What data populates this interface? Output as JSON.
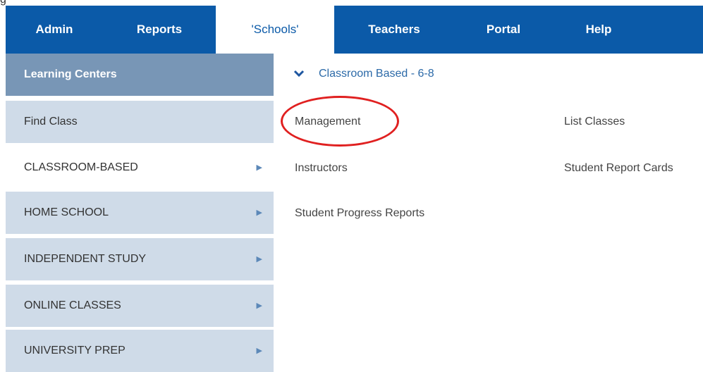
{
  "top_glyph": "g",
  "nav": {
    "tabs": [
      {
        "label": "Admin"
      },
      {
        "label": "Reports"
      },
      {
        "label": "'Schools'"
      },
      {
        "label": "Teachers"
      },
      {
        "label": "Portal"
      },
      {
        "label": "Help"
      }
    ]
  },
  "sidebar": {
    "header": "Learning Centers",
    "items": [
      {
        "label": "Find Class"
      },
      {
        "label": "CLASSROOM-BASED"
      },
      {
        "label": "HOME SCHOOL"
      },
      {
        "label": "INDEPENDENT STUDY"
      },
      {
        "label": "ONLINE CLASSES"
      },
      {
        "label": "UNIVERSITY PREP"
      }
    ]
  },
  "content": {
    "section_title": "Classroom Based - 6-8",
    "links": [
      {
        "label": "Management"
      },
      {
        "label": "List Classes"
      },
      {
        "label": "Instructors"
      },
      {
        "label": "Student Report Cards"
      },
      {
        "label": "Student Progress Reports"
      }
    ]
  },
  "colors": {
    "nav_bg": "#0b5aa8",
    "sidebar_header": "#7896b6",
    "sidebar_item": "#cfdbe8",
    "annotation": "#e02020"
  }
}
